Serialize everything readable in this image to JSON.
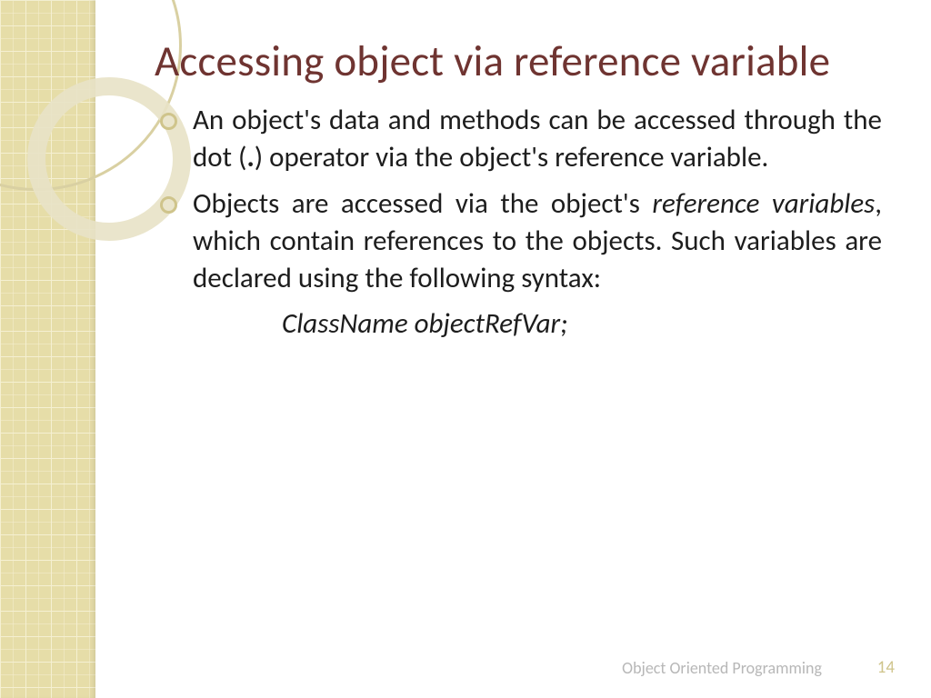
{
  "slide": {
    "title": "Accessing object via reference variable",
    "bullets": [
      {
        "html": "An object's data and methods can be accessed through the dot (<b>.</b>) operator via the object's reference variable."
      },
      {
        "html": "Objects are accessed via the object's <em>reference variables</em>, which contain references to the objects. Such variables are declared using the following syntax:"
      }
    ],
    "code_line": "ClassName objectRefVar;",
    "footer": "Object Oriented Programming",
    "page_number": "14"
  }
}
